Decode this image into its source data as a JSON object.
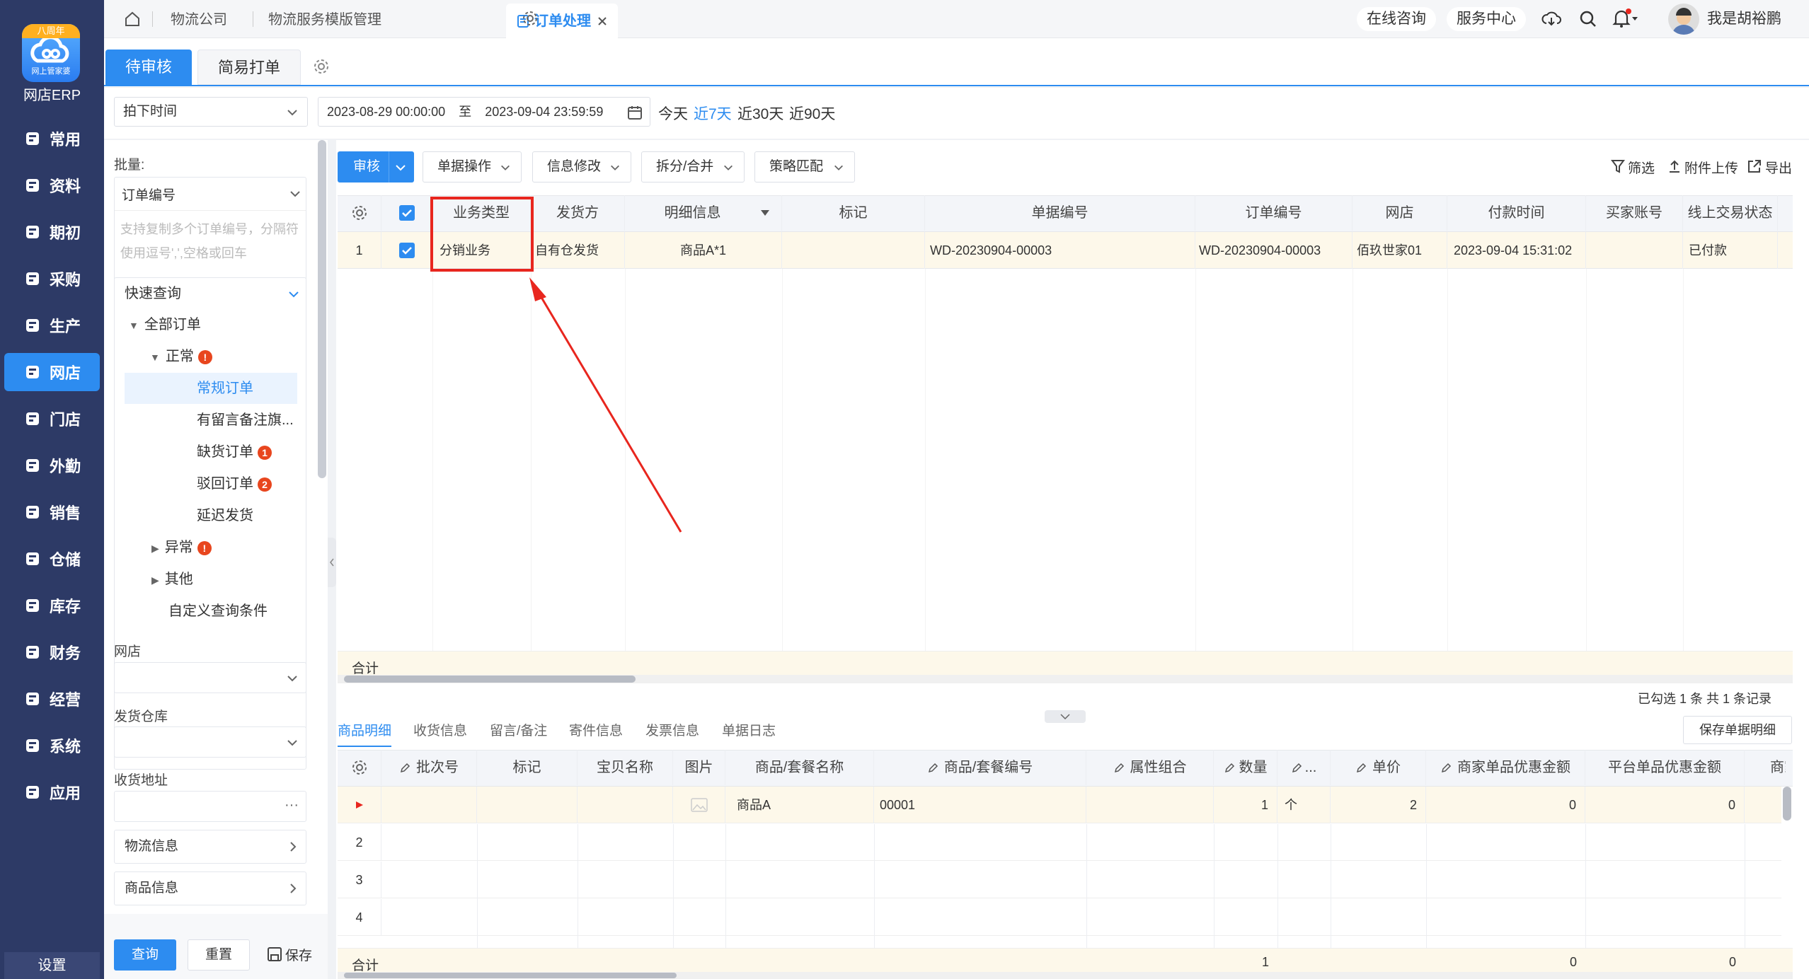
{
  "nav": {
    "logo_badge": "八周年",
    "logo_sub": "网上管家婆",
    "app_name": "网店ERP",
    "items": [
      {
        "label": "常用",
        "icon": "star-icon"
      },
      {
        "label": "资料",
        "icon": "document-icon"
      },
      {
        "label": "期初",
        "icon": "target-icon"
      },
      {
        "label": "采购",
        "icon": "purchase-icon"
      },
      {
        "label": "生产",
        "icon": "production-icon"
      },
      {
        "label": "网店",
        "icon": "store-icon"
      },
      {
        "label": "门店",
        "icon": "shop-icon"
      },
      {
        "label": "外勤",
        "icon": "field-icon"
      },
      {
        "label": "销售",
        "icon": "sales-icon"
      },
      {
        "label": "仓储",
        "icon": "warehouse-icon"
      },
      {
        "label": "库存",
        "icon": "inventory-icon"
      },
      {
        "label": "财务",
        "icon": "finance-icon"
      },
      {
        "label": "经营",
        "icon": "business-icon"
      },
      {
        "label": "系统",
        "icon": "system-icon"
      },
      {
        "label": "应用",
        "icon": "apps-icon"
      }
    ],
    "active_index": 5,
    "settings": "设置"
  },
  "topbar": {
    "tabs": [
      "物流公司",
      "物流服务模版管理"
    ],
    "active_tab": "订单处理",
    "consult": "在线咨询",
    "service": "服务中心",
    "user": "我是胡裕鹏"
  },
  "subtabs": {
    "pending": "待审核",
    "simple": "简易打单"
  },
  "filters": {
    "time_type": "拍下时间",
    "start": "2023-08-29 00:00:00",
    "to": "至",
    "end": "2023-09-04 23:59:59",
    "quick": [
      "今天",
      "近7天",
      "近30天",
      "近90天"
    ],
    "quick_active": 1
  },
  "sidebar": {
    "batch_label": "批量:",
    "batch_field": "订单编号",
    "batch_placeholder": "支持复制多个订单编号，分隔符使用逗号',',空格或回车",
    "quick_query": "快速查询",
    "tree": {
      "all": "全部订单",
      "normal": "正常",
      "regular": "常规订单",
      "remark": "有留言备注旗...",
      "short": "缺货订单",
      "short_count": "1",
      "reject": "驳回订单",
      "reject_count": "2",
      "delay": "延迟发货",
      "abnormal": "异常",
      "other": "其他",
      "custom": "自定义查询条件"
    },
    "shop_label": "网店",
    "warehouse_label": "发货仓库",
    "address_label": "收货地址",
    "logistics": "物流信息",
    "goods": "商品信息",
    "query": "查询",
    "reset": "重置",
    "save": "保存"
  },
  "toolbar": {
    "approve": "审核",
    "menus": [
      "单据操作",
      "信息修改",
      "拆分/合并",
      "策略匹配"
    ],
    "filter": "筛选",
    "upload": "附件上传",
    "export": "导出"
  },
  "order_table": {
    "headers": [
      "业务类型",
      "发货方",
      "明细信息",
      "标记",
      "单据编号",
      "订单编号",
      "网店",
      "付款时间",
      "买家账号",
      "线上交易状态"
    ],
    "row": {
      "index": "1",
      "biz_type": "分销业务",
      "shipper": "自有仓发货",
      "detail": "商品A*1",
      "mark": "",
      "bill_no": "WD-20230904-00003",
      "order_no": "WD-20230904-00003",
      "shop": "佰玖世家01",
      "pay_time": "2023-09-04 15:31:02",
      "buyer": "",
      "status": "已付款"
    },
    "total": "合计",
    "summary": "已勾选 1 条 共 1 条记录"
  },
  "bottom_tabs": [
    "商品明细",
    "收货信息",
    "留言/备注",
    "寄件信息",
    "发票信息",
    "单据日志"
  ],
  "save_detail": "保存单据明细",
  "detail_table": {
    "headers": [
      "批次号",
      "标记",
      "宝贝名称",
      "图片",
      "商品/套餐名称",
      "商品/套餐编号",
      "属性组合",
      "数量",
      "...",
      "单价",
      "商家单品优惠金额",
      "平台单品优惠金额",
      "商家"
    ],
    "row": {
      "name": "商品A",
      "code": "00001",
      "qty": "1",
      "unit": "个",
      "price": "2",
      "merchant_disc": "0",
      "platform_disc": "0"
    },
    "row_numbers": [
      "2",
      "3",
      "4"
    ],
    "total": "合计",
    "total_qty": "1",
    "total_merchant": "0",
    "total_platform": "0"
  }
}
